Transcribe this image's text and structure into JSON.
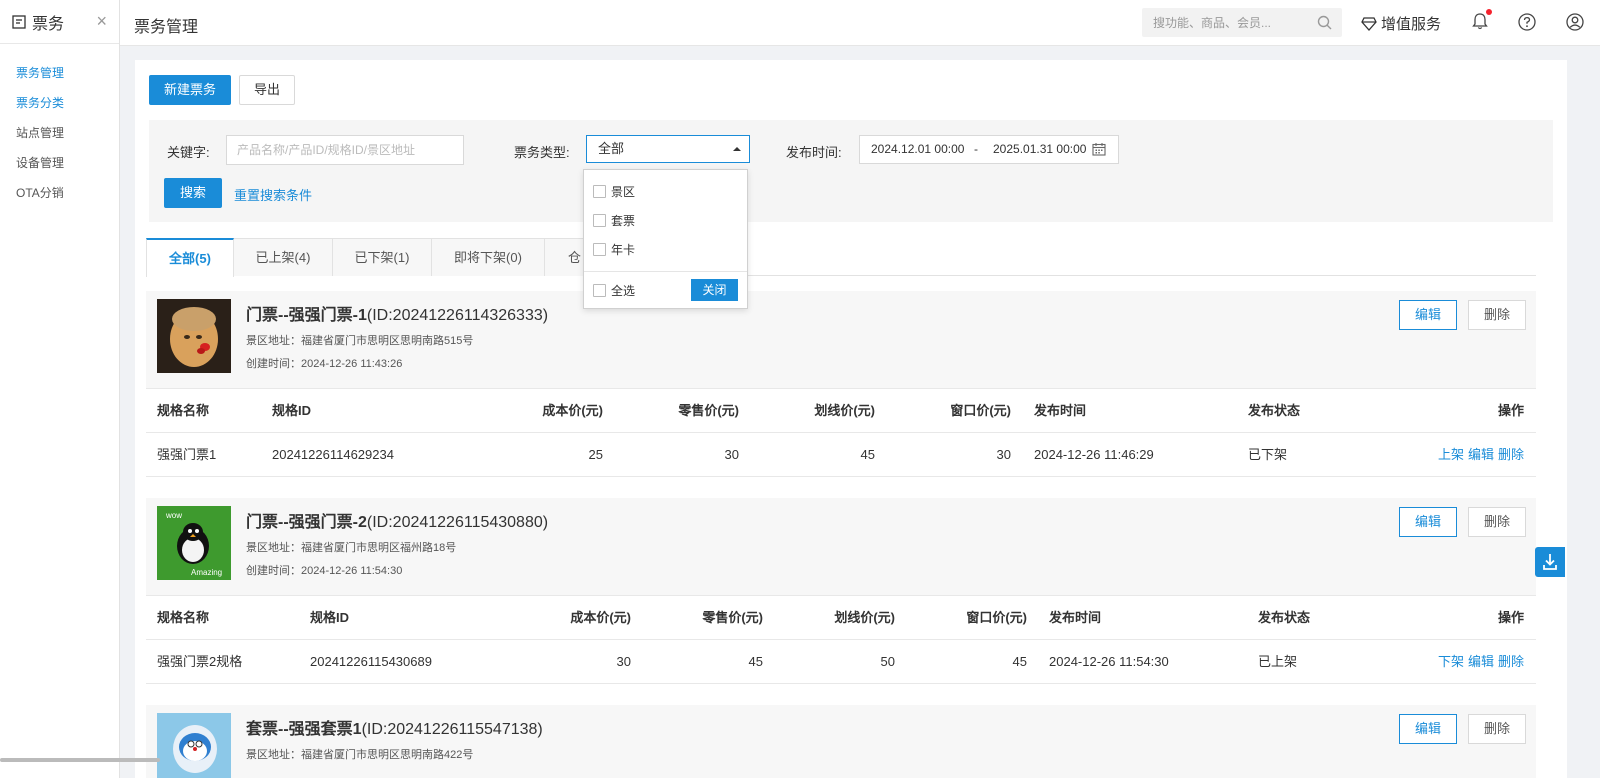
{
  "sidebar": {
    "title": "票务",
    "items": [
      {
        "label": "票务管理"
      },
      {
        "label": "票务分类"
      },
      {
        "label": "站点管理"
      },
      {
        "label": "设备管理"
      },
      {
        "label": "OTA分销"
      }
    ]
  },
  "header": {
    "page_title": "票务管理",
    "search_placeholder": "搜功能、商品、会员...",
    "vas_label": "增值服务"
  },
  "toolbar": {
    "new_label": "新建票务",
    "export_label": "导出"
  },
  "filter": {
    "keyword_label": "关键字:",
    "keyword_placeholder": "产品名称/产品ID/规格ID/景区地址",
    "type_label": "票务类型:",
    "type_value": "全部",
    "date_label": "发布时间:",
    "date_start": "2024.12.01 00:00",
    "date_sep": "-",
    "date_end": "2025.01.31 00:00",
    "search_label": "搜索",
    "reset_label": "重置搜索条件"
  },
  "type_dropdown": {
    "options": [
      {
        "label": "景区"
      },
      {
        "label": "套票"
      },
      {
        "label": "年卡"
      }
    ],
    "select_all": "全选",
    "close_label": "关闭"
  },
  "tabs": [
    {
      "label": "全部(5)",
      "active": true
    },
    {
      "label": "已上架(4)"
    },
    {
      "label": "已下架(1)"
    },
    {
      "label": "即将下架(0)"
    },
    {
      "label": "仓"
    }
  ],
  "spec_headers": {
    "name": "规格名称",
    "id": "规格ID",
    "cost": "成本价(元)",
    "retail": "零售价(元)",
    "strike": "划线价(元)",
    "window": "窗口价(元)",
    "pub_time": "发布时间",
    "status": "发布状态",
    "ops": "操作"
  },
  "products": [
    {
      "name_bold": "门票--强强门票-1",
      "name_id": "(ID:20241226114326333)",
      "address": "景区地址：福建省厦门市思明区思明南路515号",
      "created": "创建时间：2024-12-26 11:43:26",
      "edit_label": "编辑",
      "delete_label": "删除",
      "spec": {
        "name": "强强门票1",
        "id": "20241226114629234",
        "cost": "25",
        "retail": "30",
        "strike": "45",
        "window": "30",
        "pub_time": "2024-12-26 11:46:29",
        "status": "已下架",
        "op_toggle": "上架",
        "op_edit": "编辑",
        "op_delete": "删除"
      }
    },
    {
      "name_bold": "门票--强强门票-2",
      "name_id": "(ID:20241226115430880)",
      "address": "景区地址：福建省厦门市思明区福州路18号",
      "created": "创建时间：2024-12-26 11:54:30",
      "edit_label": "编辑",
      "delete_label": "删除",
      "thumb_text_top": "wow",
      "thumb_text_bottom": "Amazing",
      "spec": {
        "name": "强强门票2规格",
        "id": "20241226115430689",
        "cost": "30",
        "retail": "45",
        "strike": "50",
        "window": "45",
        "pub_time": "2024-12-26 11:54:30",
        "status": "已上架",
        "op_toggle": "下架",
        "op_edit": "编辑",
        "op_delete": "删除"
      }
    },
    {
      "name_bold": "套票--强强套票1",
      "name_id": "(ID:20241226115547138)",
      "address": "景区地址：福建省厦门市思明区思明南路422号",
      "edit_label": "编辑",
      "delete_label": "删除"
    }
  ],
  "colors": {
    "accent": "#1a8cd8",
    "badge": "#f5222d"
  }
}
